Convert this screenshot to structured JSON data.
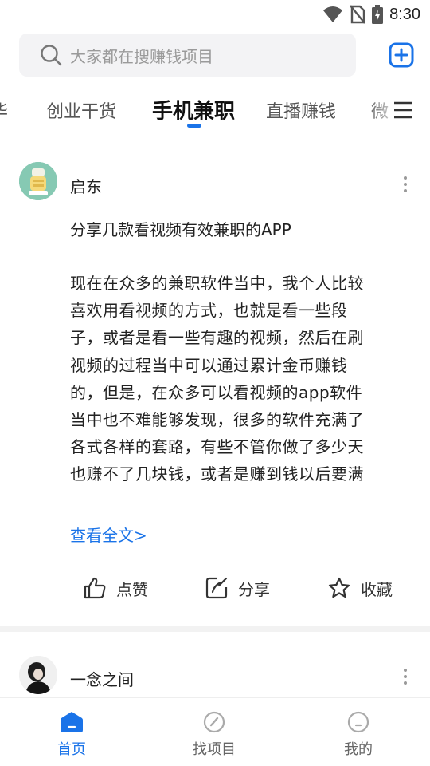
{
  "status_bar": {
    "time": "8:30"
  },
  "search": {
    "placeholder": "大家都在搜赚钱项目"
  },
  "tabs": [
    {
      "label": "华"
    },
    {
      "label": "创业干货"
    },
    {
      "label": "手机兼职",
      "active": true
    },
    {
      "label": "直播赚钱"
    },
    {
      "label": "微"
    }
  ],
  "posts": [
    {
      "author": "启东",
      "title": "分享几款看视频有效兼职的APP",
      "body_lines": [
        "现在在众多的兼职软件当中，我个人比较",
        "喜欢用看视频的方式，也就是看一些段",
        "子，或者是看一些有趣的视频，然后在刷",
        "视频的过程当中可以通过累计金币赚钱",
        "的，但是，在众多可以看视频的app软件",
        "当中也不难能够发现，很多的软件充满了",
        "各式各样的套路，有些不管你做了多少天",
        "也赚不了几块钱，或者是赚到钱以后要满"
      ],
      "read_more": "查看全文>",
      "actions": {
        "like": "点赞",
        "share": "分享",
        "favorite": "收藏"
      }
    },
    {
      "author": "一念之间"
    }
  ],
  "bottom_nav": [
    {
      "label": "首页",
      "active": true
    },
    {
      "label": "找项目"
    },
    {
      "label": "我的"
    }
  ],
  "colors": {
    "accent": "#1a73e8",
    "text": "#222222",
    "muted": "#9a9a9a"
  }
}
